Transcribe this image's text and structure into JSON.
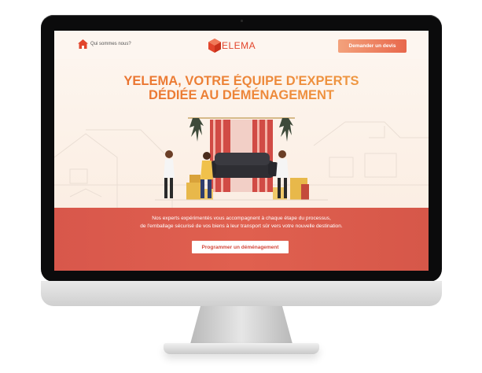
{
  "nav": {
    "about_label": "Qui sommes nous?",
    "logo_text": "ELEMA",
    "quote_button": "Demander un devis"
  },
  "hero": {
    "title_line1": "YELEMA, VOTRE ÉQUIPE D'EXPERTS",
    "title_line2": "DÉDIÉE AU DÉMÉNAGEMENT"
  },
  "band": {
    "text_line1": "Nos experts expérimentés vous accompagnent à chaque étape du processus,",
    "text_line2": "de l'emballage sécurisé de vos biens à leur transport sûr vers votre nouvelle destination.",
    "cta_label": "Programmer un déménagement"
  },
  "colors": {
    "brand": "#e2452c",
    "accent_gradient_start": "#f3a27c",
    "accent_gradient_end": "#e8684c",
    "band": "#dc5a4c"
  },
  "icons": [
    "home-icon",
    "logo-mark-icon"
  ]
}
